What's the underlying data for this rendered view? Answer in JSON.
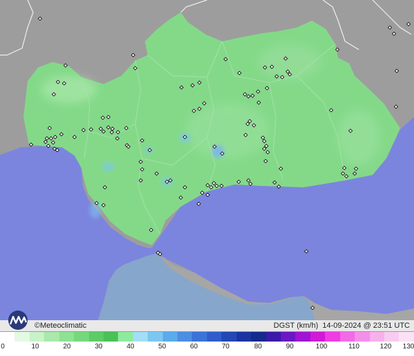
{
  "brand": {
    "copyright": "©",
    "name": "Meteoclimatic"
  },
  "info": {
    "variable": "DGST",
    "unit": "(km/h)",
    "date": "14-09-2024",
    "time": "23:51",
    "tz": "UTC"
  },
  "colors": {
    "sea": "#7b85de",
    "land_outside": "#9b9b9b",
    "region": "#84d989",
    "africa": "#87a9c9",
    "border": "#ffffff"
  },
  "legend": {
    "ticks": [
      "0",
      "10",
      "20",
      "30",
      "40",
      "50",
      "60",
      "70",
      "80",
      "90",
      "100",
      "110",
      "120",
      "130"
    ],
    "colors": [
      "#ffffff",
      "#e4f9e4",
      "#c8f2c8",
      "#a9e9ab",
      "#8ee293",
      "#76d87d",
      "#5ccd66",
      "#49c159",
      "#8eea9e",
      "#a3ddf7",
      "#7cc6f2",
      "#5aabec",
      "#4b8fe4",
      "#3c73d9",
      "#2f5dca",
      "#2447b6",
      "#1b34a0",
      "#142a8c",
      "#3b1aa8",
      "#6a18c4",
      "#a014d4",
      "#d01ad6",
      "#ee3de2",
      "#f26ae6",
      "#f48fe9",
      "#f6b0ec",
      "#f8ccf0",
      "#fae1f4"
    ]
  }
}
